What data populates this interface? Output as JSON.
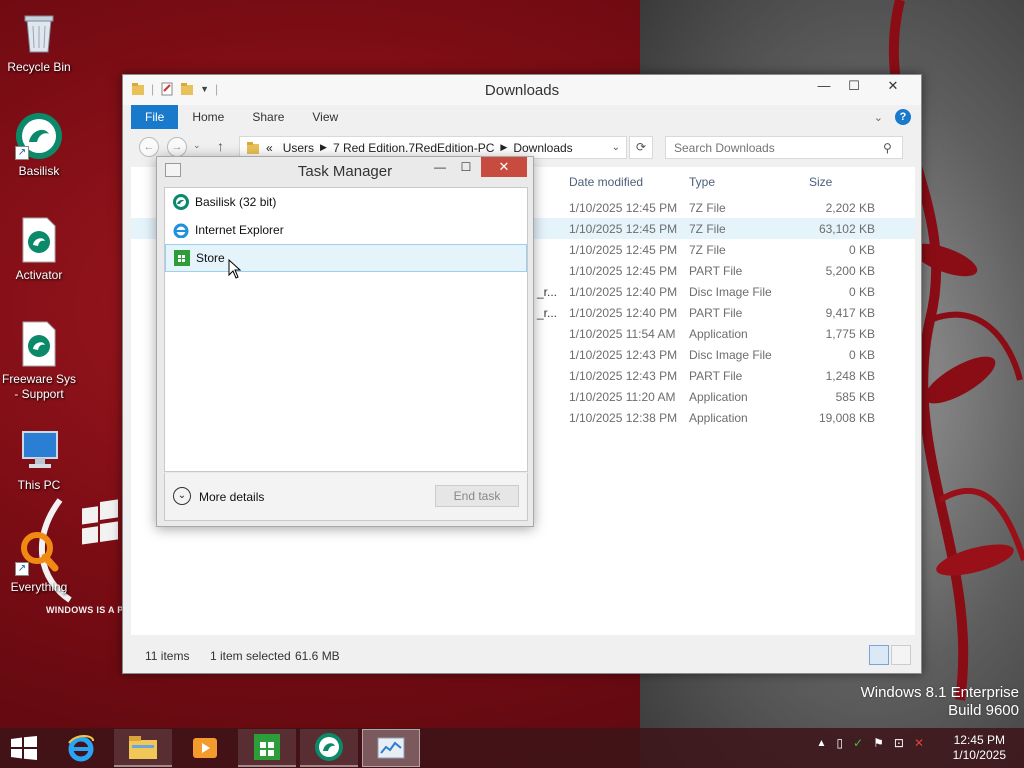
{
  "desktop": {
    "icons": [
      {
        "label": "Recycle Bin"
      },
      {
        "label": "Basilisk"
      },
      {
        "label": "Activator"
      },
      {
        "label": "Freeware Sys - Support"
      },
      {
        "label": "This PC"
      },
      {
        "label": "Everything"
      }
    ],
    "wallpaper_text": "WINDOWS IS A PROU",
    "watermark_line1": "Windows 8.1 Enterprise",
    "watermark_line2": "Build 9600"
  },
  "explorer": {
    "title": "Downloads",
    "tabs": [
      "File",
      "Home",
      "Share",
      "View"
    ],
    "breadcrumb": {
      "prefix": "«",
      "parts": [
        "Users",
        "7 Red Edition.7RedEdition-PC",
        "Downloads"
      ]
    },
    "search_placeholder": "Search Downloads",
    "columns": [
      "Date modified",
      "Type",
      "Size"
    ],
    "rows": [
      {
        "date": "1/10/2025 12:45 PM",
        "type": "7Z File",
        "size": "2,202 KB"
      },
      {
        "date": "1/10/2025 12:45 PM",
        "type": "7Z File",
        "size": "63,102 KB",
        "selected": true
      },
      {
        "date": "1/10/2025 12:45 PM",
        "type": "7Z File",
        "size": "0 KB"
      },
      {
        "date": "1/10/2025 12:45 PM",
        "type": "PART File",
        "size": "5,200 KB"
      },
      {
        "date": "1/10/2025 12:40 PM",
        "type": "Disc Image File",
        "size": "0 KB",
        "name_fragment": "_r..."
      },
      {
        "date": "1/10/2025 12:40 PM",
        "type": "PART File",
        "size": "9,417 KB",
        "name_fragment": "_r..."
      },
      {
        "date": "1/10/2025 11:54 AM",
        "type": "Application",
        "size": "1,775 KB"
      },
      {
        "date": "1/10/2025 12:43 PM",
        "type": "Disc Image File",
        "size": "0 KB"
      },
      {
        "date": "1/10/2025 12:43 PM",
        "type": "PART File",
        "size": "1,248 KB"
      },
      {
        "date": "1/10/2025 11:20 AM",
        "type": "Application",
        "size": "585 KB"
      },
      {
        "date": "1/10/2025 12:38 PM",
        "type": "Application",
        "size": "19,008 KB"
      }
    ],
    "status": {
      "items": "11 items",
      "selected": "1 item selected",
      "size": "61.6 MB"
    }
  },
  "task_manager": {
    "title": "Task Manager",
    "apps": [
      {
        "name": "Basilisk (32 bit)",
        "icon": "basilisk-icon"
      },
      {
        "name": "Internet Explorer",
        "icon": "ie-icon"
      },
      {
        "name": "Store",
        "icon": "store-icon",
        "selected": true
      }
    ],
    "more_details": "More details",
    "end_task": "End task"
  },
  "taskbar": {
    "items": [
      "start",
      "internet-explorer",
      "file-explorer",
      "media-player",
      "store",
      "basilisk",
      "task-manager"
    ],
    "clock_time": "12:45 PM",
    "clock_date": "1/10/2025"
  },
  "colors": {
    "accent": "#1979ca",
    "close_red": "#c74b3f",
    "selection": "#e5f3fb"
  }
}
